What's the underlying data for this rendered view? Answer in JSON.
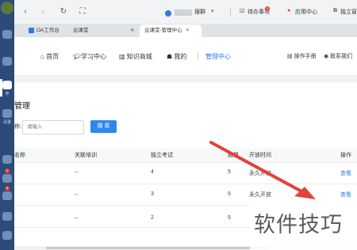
{
  "browser": {
    "page_title": "搜群",
    "todo_label": "待办事项",
    "todo_badge": "1",
    "app_center_label": "应用中心",
    "standalone_label": "独立窗"
  },
  "tabs": [
    {
      "label": "OA工作台",
      "active": false
    },
    {
      "label": "云课堂",
      "active": false
    },
    {
      "label": "云课堂-管理中心",
      "active": true
    }
  ],
  "left_rail": {
    "items": [
      "作",
      "讯录"
    ],
    "badges": [
      "1",
      "3"
    ]
  },
  "nav": {
    "items": [
      {
        "label": "首页",
        "icon": "home-icon"
      },
      {
        "label": "学习中心",
        "icon": "graduation-cap-icon"
      },
      {
        "label": "知识商城",
        "icon": "library-icon"
      },
      {
        "label": "我的",
        "icon": "user-icon"
      },
      {
        "label": "管理中心",
        "icon": "",
        "active": true
      }
    ],
    "manual_label": "操作手册",
    "contact_label": "联系我们"
  },
  "page": {
    "title": "管理",
    "search_label": "称:",
    "search_placeholder": "请输入",
    "search_button": "搜 索"
  },
  "table": {
    "columns": [
      "名称",
      "关联培训",
      "独立考试",
      "题量",
      "开放时间",
      "操作"
    ],
    "rows": [
      {
        "training": "--",
        "exam": "4",
        "count": "5",
        "time": "永久开放",
        "action": "查看"
      },
      {
        "training": "--",
        "exam": "3",
        "count": "5",
        "time": "永久开放",
        "action": "查看"
      },
      {
        "training": "--",
        "exam": "2",
        "count": "5",
        "time": "",
        "action": ""
      }
    ]
  },
  "watermark": "软件技巧",
  "colors": {
    "accent": "#2f7be5",
    "button": "#2f86f0",
    "rail": "#2c4a7a",
    "arrow": "#e2433b"
  }
}
